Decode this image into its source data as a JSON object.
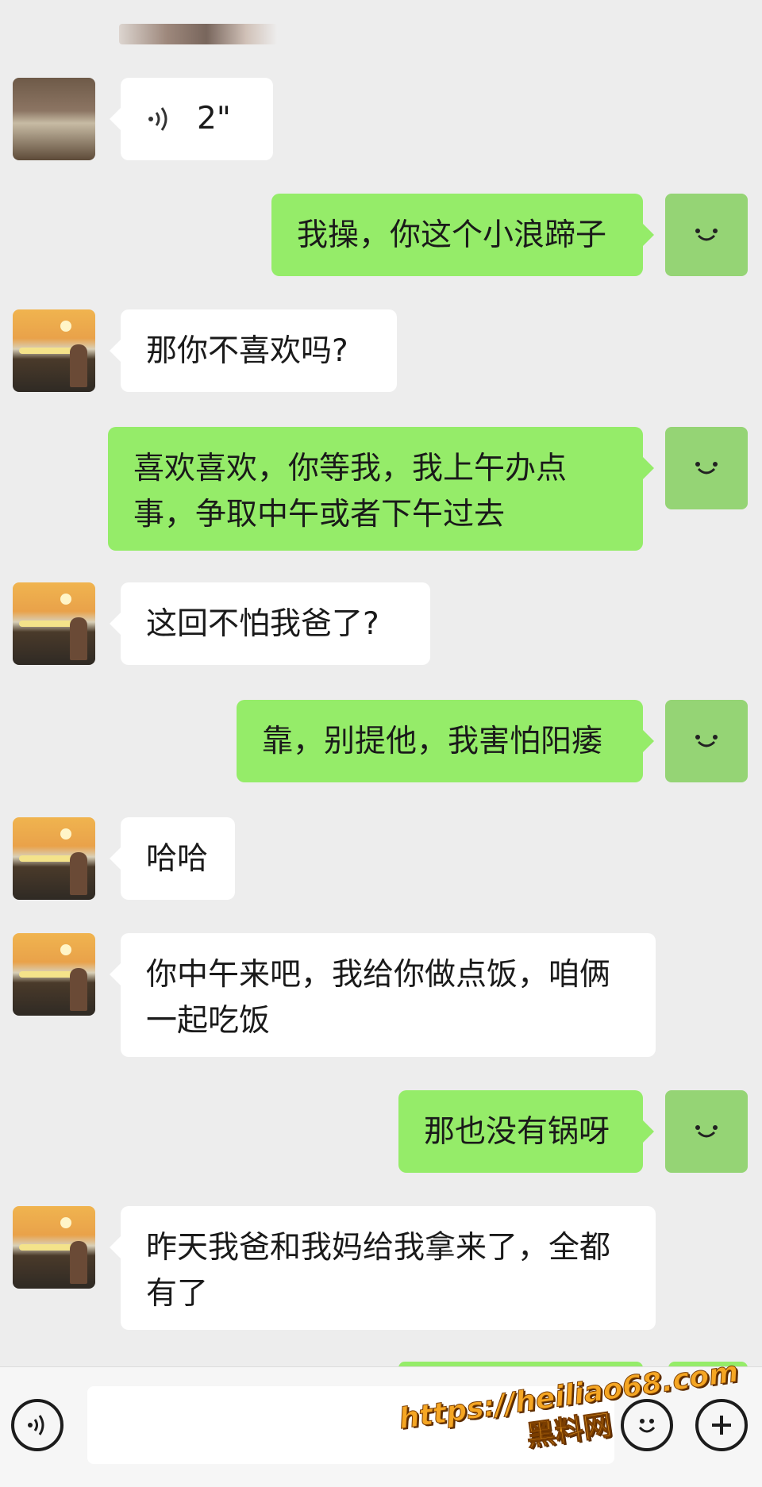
{
  "messages": [
    {
      "side": "in",
      "type": "voice",
      "duration": "2\""
    },
    {
      "side": "out",
      "text": "我操，你这个小浪蹄子"
    },
    {
      "side": "in",
      "text": "那你不喜欢吗?"
    },
    {
      "side": "out",
      "text": "喜欢喜欢，你等我，我上午办点事，争取中午或者下午过去"
    },
    {
      "side": "in",
      "text": "这回不怕我爸了?"
    },
    {
      "side": "out",
      "text": "靠，别提他，我害怕阳痿"
    },
    {
      "side": "in",
      "text": "哈哈"
    },
    {
      "side": "in",
      "text": "你中午来吧，我给你做点饭，咱俩一起吃饭"
    },
    {
      "side": "out",
      "text": "那也没有锅呀"
    },
    {
      "side": "in",
      "text": "昨天我爸和我妈给我拿来了，全都有了"
    }
  ],
  "input_bar": {
    "left_icon": "voice-icon",
    "right_icons": [
      "emoji-icon",
      "plus-icon"
    ],
    "input_value": ""
  },
  "watermark": {
    "url": "https://heiliao68.com",
    "name": "黑料网"
  },
  "colors": {
    "background": "#ededed",
    "incoming": "#ffffff",
    "outgoing": "#95ec69",
    "self_avatar": "#95d475"
  }
}
